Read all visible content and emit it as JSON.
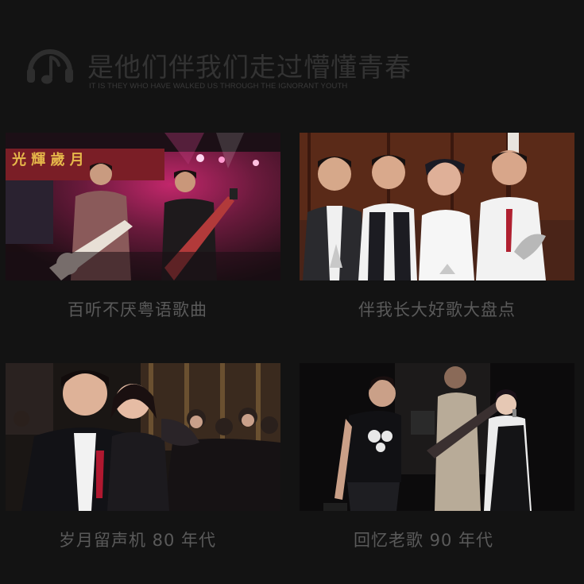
{
  "header": {
    "title": "是他们伴我们走过懵懂青春",
    "subtitle": "IT IS THEY WHO HAVE WALKED US THROUGH THE IGNORANT YOUTH",
    "logo_icon": "headphone-music-note-icon"
  },
  "cards": [
    {
      "caption": "百听不厌粤语歌曲",
      "photo_sign_text": "光 輝 歲 月"
    },
    {
      "caption": "伴我长大好歌大盘点"
    },
    {
      "caption": "岁月留声机 80 年代"
    },
    {
      "caption": "回忆老歌 90 年代"
    }
  ],
  "colors": {
    "background": "#131313",
    "title_text": "#333333",
    "caption_text": "#5a5a5a"
  }
}
